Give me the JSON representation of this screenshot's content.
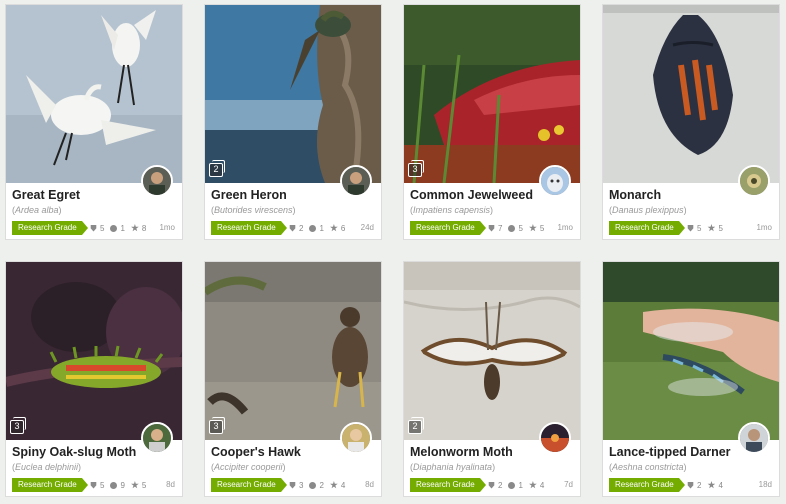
{
  "observations": [
    {
      "common_name": "Great Egret",
      "scientific_name": "Ardea alba",
      "quality_grade": "Research Grade",
      "photo_count": "",
      "identifications": "5",
      "comments": "1",
      "faves": "8",
      "time_ago": "1mo"
    },
    {
      "common_name": "Green Heron",
      "scientific_name": "Butorides virescens",
      "quality_grade": "Research Grade",
      "photo_count": "2",
      "identifications": "2",
      "comments": "1",
      "faves": "6",
      "time_ago": "24d"
    },
    {
      "common_name": "Common Jewelweed",
      "scientific_name": "Impatiens capensis",
      "quality_grade": "Research Grade",
      "photo_count": "3",
      "identifications": "7",
      "comments": "5",
      "faves": "5",
      "time_ago": "1mo"
    },
    {
      "common_name": "Monarch",
      "scientific_name": "Danaus plexippus",
      "quality_grade": "Research Grade",
      "photo_count": "",
      "identifications": "5",
      "comments": "",
      "faves": "5",
      "time_ago": "1mo"
    },
    {
      "common_name": "Spiny Oak-slug Moth",
      "scientific_name": "Euclea delphinii",
      "quality_grade": "Research Grade",
      "photo_count": "3",
      "identifications": "5",
      "comments": "9",
      "faves": "5",
      "time_ago": "8d"
    },
    {
      "common_name": "Cooper's Hawk",
      "scientific_name": "Accipiter cooperii",
      "quality_grade": "Research Grade",
      "photo_count": "3",
      "identifications": "3",
      "comments": "2",
      "faves": "4",
      "time_ago": "8d"
    },
    {
      "common_name": "Melonworm Moth",
      "scientific_name": "Diaphania hyalinata",
      "quality_grade": "Research Grade",
      "photo_count": "2",
      "identifications": "2",
      "comments": "1",
      "faves": "4",
      "time_ago": "7d"
    },
    {
      "common_name": "Lance-tipped Darner",
      "scientific_name": "Aeshna constricta",
      "quality_grade": "Research Grade",
      "photo_count": "",
      "identifications": "2",
      "comments": "",
      "faves": "4",
      "time_ago": "18d"
    }
  ],
  "colors": {
    "research_grade": "#74ac00",
    "card_bg": "#ffffff",
    "page_bg": "#eef0ee"
  }
}
